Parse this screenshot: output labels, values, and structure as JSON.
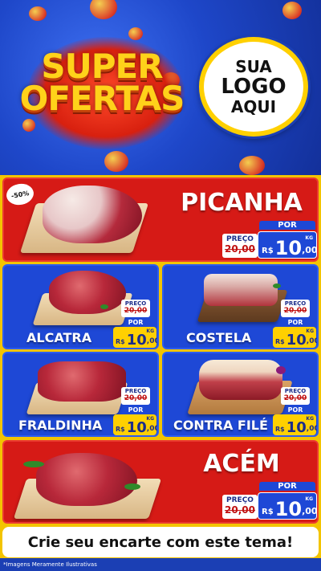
{
  "header": {
    "title_line1": "SUPER",
    "title_line2": "OFERTAS",
    "logo_line1": "SUA",
    "logo_line2": "LOGO",
    "logo_line3": "AQUI"
  },
  "colors": {
    "brand_blue": "#1e48d6",
    "brand_red": "#d61a16",
    "brand_yellow": "#ffd21a",
    "price_yellow": "#ffd000"
  },
  "products": [
    {
      "name": "PICANHA",
      "badge": "-50%",
      "preco_label": "PREÇO",
      "old_price": "20,00",
      "por_label": "POR",
      "currency": "R$",
      "price_int": "10",
      "price_dec": ",00",
      "unit": "KG"
    },
    {
      "name": "ALCATRA",
      "preco_label": "PREÇO",
      "old_price": "20,00",
      "por_label": "POR",
      "currency": "R$",
      "price_int": "10",
      "price_dec": ",00",
      "unit": "KG"
    },
    {
      "name": "COSTELA",
      "preco_label": "PREÇO",
      "old_price": "20,00",
      "por_label": "POR",
      "currency": "R$",
      "price_int": "10",
      "price_dec": ",00",
      "unit": "KG"
    },
    {
      "name": "FRALDINHA",
      "preco_label": "PREÇO",
      "old_price": "20,00",
      "por_label": "POR",
      "currency": "R$",
      "price_int": "10",
      "price_dec": ",00",
      "unit": "KG"
    },
    {
      "name": "CONTRA FILÉ",
      "preco_label": "PREÇO",
      "old_price": "20,00",
      "por_label": "POR",
      "currency": "R$",
      "price_int": "10",
      "price_dec": ",00",
      "unit": "KG"
    },
    {
      "name": "ACÉM",
      "preco_label": "PREÇO",
      "old_price": "20,00",
      "por_label": "POR",
      "currency": "R$",
      "price_int": "10",
      "price_dec": ",00",
      "unit": "KG"
    }
  ],
  "cta": {
    "text": "Crie seu encarte com este tema!"
  },
  "footer": {
    "disclaimer": "*Imagens Meramente Ilustrativas"
  }
}
